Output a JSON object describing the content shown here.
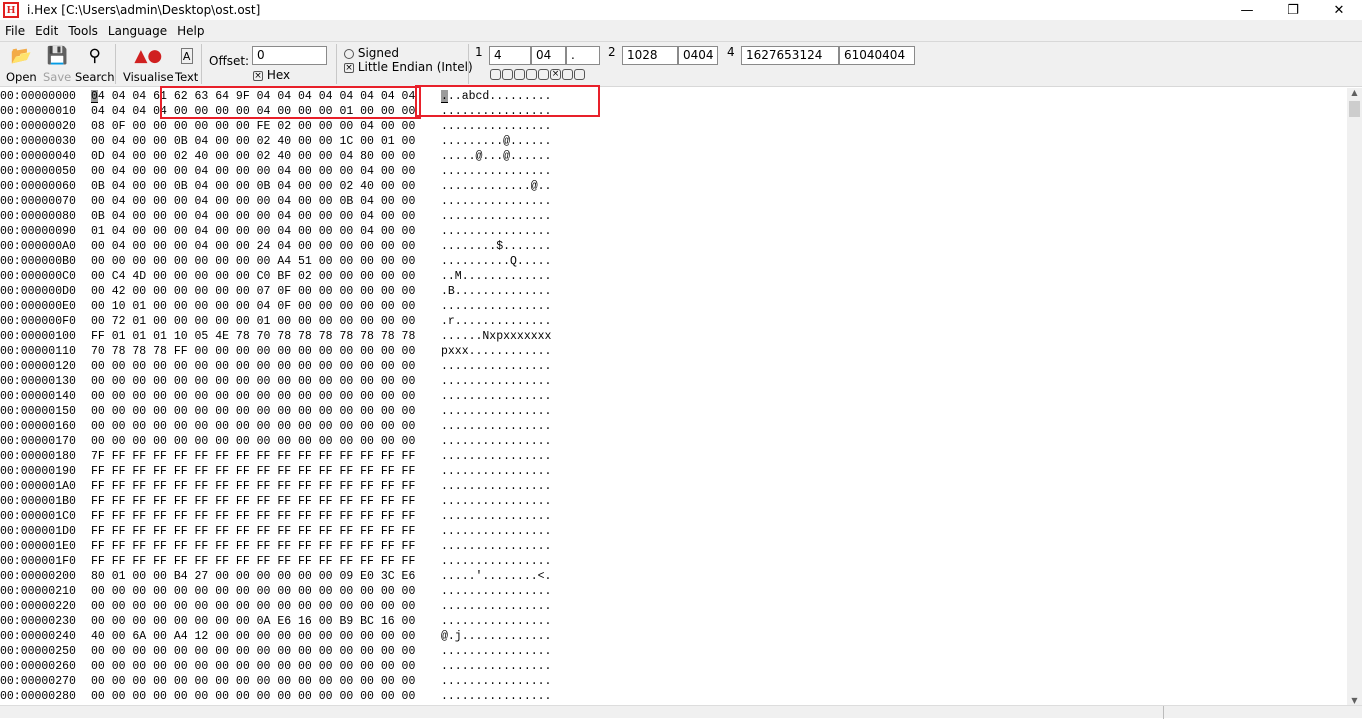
{
  "window": {
    "title": "i.Hex [C:\\Users\\admin\\Desktop\\ost.ost]",
    "icon_letter": "H"
  },
  "menu": [
    "File",
    "Edit",
    "Tools",
    "Language",
    "Help"
  ],
  "toolbar": {
    "open": "Open",
    "save": "Save",
    "search": "Search",
    "visualise": "Visualise",
    "text": "Text",
    "offset_label": "Offset:",
    "offset_value": "0",
    "hex_label": "Hex",
    "hex_checked": true,
    "signed_label": "Signed",
    "signed_checked": false,
    "endian_label": "Little Endian (Intel)",
    "endian_checked": true
  },
  "inspector": {
    "l1": "1",
    "v1_dec": "4",
    "v1_hex": "04",
    "v1_char": ".",
    "l2": "2",
    "v2_dec": "1028",
    "v2_hex": "0404",
    "l4": "4",
    "v4_dec": "1627653124",
    "v4_hex": "61040404",
    "bits": [
      false,
      false,
      false,
      false,
      false,
      true,
      false,
      false
    ]
  },
  "colors": {
    "highlight": "#e8202a",
    "cursor": "#9a9a9a"
  },
  "rows": [
    {
      "addr": "00:00000000",
      "hex": "04 04 04 61 62 63 64 9F 04 04 04 04 04 04 04 04",
      "ascii": "...abcd........."
    },
    {
      "addr": "00:00000010",
      "hex": "04 04 04 04 00 00 00 00 04 00 00 00 01 00 00 00",
      "ascii": "................"
    },
    {
      "addr": "00:00000020",
      "hex": "08 0F 00 00 00 00 00 00 FE 02 00 00 00 04 00 00",
      "ascii": "................"
    },
    {
      "addr": "00:00000030",
      "hex": "00 04 00 00 0B 04 00 00 02 40 00 00 1C 00 01 00",
      "ascii": ".........@......"
    },
    {
      "addr": "00:00000040",
      "hex": "0D 04 00 00 02 40 00 00 02 40 00 00 04 80 00 00",
      "ascii": ".....@...@......"
    },
    {
      "addr": "00:00000050",
      "hex": "00 04 00 00 00 04 00 00 00 04 00 00 00 04 00 00",
      "ascii": "................"
    },
    {
      "addr": "00:00000060",
      "hex": "0B 04 00 00 0B 04 00 00 0B 04 00 00 02 40 00 00",
      "ascii": ".............@.."
    },
    {
      "addr": "00:00000070",
      "hex": "00 04 00 00 00 04 00 00 00 04 00 00 0B 04 00 00",
      "ascii": "................"
    },
    {
      "addr": "00:00000080",
      "hex": "0B 04 00 00 00 04 00 00 00 04 00 00 00 04 00 00",
      "ascii": "................"
    },
    {
      "addr": "00:00000090",
      "hex": "01 04 00 00 00 04 00 00 00 04 00 00 00 04 00 00",
      "ascii": "................"
    },
    {
      "addr": "00:000000A0",
      "hex": "00 04 00 00 00 04 00 00 24 04 00 00 00 00 00 00",
      "ascii": "........$......."
    },
    {
      "addr": "00:000000B0",
      "hex": "00 00 00 00 00 00 00 00 00 A4 51 00 00 00 00 00",
      "ascii": "..........Q....."
    },
    {
      "addr": "00:000000C0",
      "hex": "00 C4 4D 00 00 00 00 00 C0 BF 02 00 00 00 00 00",
      "ascii": "..M............."
    },
    {
      "addr": "00:000000D0",
      "hex": "00 42 00 00 00 00 00 00 07 0F 00 00 00 00 00 00",
      "ascii": ".B.............."
    },
    {
      "addr": "00:000000E0",
      "hex": "00 10 01 00 00 00 00 00 04 0F 00 00 00 00 00 00",
      "ascii": "................"
    },
    {
      "addr": "00:000000F0",
      "hex": "00 72 01 00 00 00 00 00 01 00 00 00 00 00 00 00",
      "ascii": ".r.............."
    },
    {
      "addr": "00:00000100",
      "hex": "FF 01 01 01 10 05 4E 78 70 78 78 78 78 78 78 78",
      "ascii": "......Nxpxxxxxxx"
    },
    {
      "addr": "00:00000110",
      "hex": "70 78 78 78 FF 00 00 00 00 00 00 00 00 00 00 00",
      "ascii": "pxxx............"
    },
    {
      "addr": "00:00000120",
      "hex": "00 00 00 00 00 00 00 00 00 00 00 00 00 00 00 00",
      "ascii": "................"
    },
    {
      "addr": "00:00000130",
      "hex": "00 00 00 00 00 00 00 00 00 00 00 00 00 00 00 00",
      "ascii": "................"
    },
    {
      "addr": "00:00000140",
      "hex": "00 00 00 00 00 00 00 00 00 00 00 00 00 00 00 00",
      "ascii": "................"
    },
    {
      "addr": "00:00000150",
      "hex": "00 00 00 00 00 00 00 00 00 00 00 00 00 00 00 00",
      "ascii": "................"
    },
    {
      "addr": "00:00000160",
      "hex": "00 00 00 00 00 00 00 00 00 00 00 00 00 00 00 00",
      "ascii": "................"
    },
    {
      "addr": "00:00000170",
      "hex": "00 00 00 00 00 00 00 00 00 00 00 00 00 00 00 00",
      "ascii": "................"
    },
    {
      "addr": "00:00000180",
      "hex": "7F FF FF FF FF FF FF FF FF FF FF FF FF FF FF FF",
      "ascii": "................"
    },
    {
      "addr": "00:00000190",
      "hex": "FF FF FF FF FF FF FF FF FF FF FF FF FF FF FF FF",
      "ascii": "................"
    },
    {
      "addr": "00:000001A0",
      "hex": "FF FF FF FF FF FF FF FF FF FF FF FF FF FF FF FF",
      "ascii": "................"
    },
    {
      "addr": "00:000001B0",
      "hex": "FF FF FF FF FF FF FF FF FF FF FF FF FF FF FF FF",
      "ascii": "................"
    },
    {
      "addr": "00:000001C0",
      "hex": "FF FF FF FF FF FF FF FF FF FF FF FF FF FF FF FF",
      "ascii": "................"
    },
    {
      "addr": "00:000001D0",
      "hex": "FF FF FF FF FF FF FF FF FF FF FF FF FF FF FF FF",
      "ascii": "................"
    },
    {
      "addr": "00:000001E0",
      "hex": "FF FF FF FF FF FF FF FF FF FF FF FF FF FF FF FF",
      "ascii": "................"
    },
    {
      "addr": "00:000001F0",
      "hex": "FF FF FF FF FF FF FF FF FF FF FF FF FF FF FF FF",
      "ascii": "................"
    },
    {
      "addr": "00:00000200",
      "hex": "80 01 00 00 B4 27 00 00 00 00 00 00 09 E0 3C E6",
      "ascii": ".....'........<."
    },
    {
      "addr": "00:00000210",
      "hex": "00 00 00 00 00 00 00 00 00 00 00 00 00 00 00 00",
      "ascii": "................"
    },
    {
      "addr": "00:00000220",
      "hex": "00 00 00 00 00 00 00 00 00 00 00 00 00 00 00 00",
      "ascii": "................"
    },
    {
      "addr": "00:00000230",
      "hex": "00 00 00 00 00 00 00 00 0A E6 16 00 B9 BC 16 00",
      "ascii": "................"
    },
    {
      "addr": "00:00000240",
      "hex": "40 00 6A 00 A4 12 00 00 00 00 00 00 00 00 00 00",
      "ascii": "@.j............."
    },
    {
      "addr": "00:00000250",
      "hex": "00 00 00 00 00 00 00 00 00 00 00 00 00 00 00 00",
      "ascii": "................"
    },
    {
      "addr": "00:00000260",
      "hex": "00 00 00 00 00 00 00 00 00 00 00 00 00 00 00 00",
      "ascii": "................"
    },
    {
      "addr": "00:00000270",
      "hex": "00 00 00 00 00 00 00 00 00 00 00 00 00 00 00 00",
      "ascii": "................"
    },
    {
      "addr": "00:00000280",
      "hex": "00 00 00 00 00 00 00 00 00 00 00 00 00 00 00 00",
      "ascii": "................"
    }
  ]
}
